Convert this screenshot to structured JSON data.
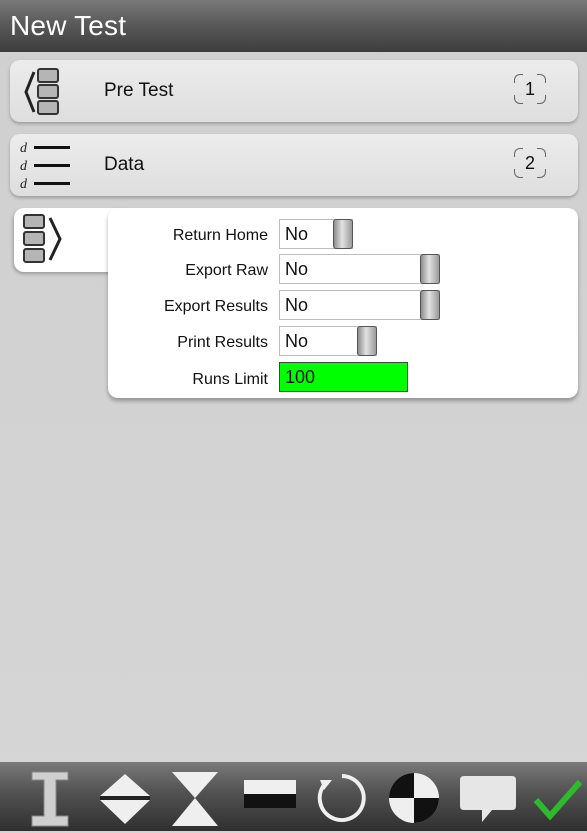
{
  "window": {
    "title": "New Test"
  },
  "rows": [
    {
      "label": "Pre Test",
      "badge": "1"
    },
    {
      "label": "Data",
      "badge": "2"
    }
  ],
  "settings": {
    "return_home": {
      "label": "Return Home",
      "value": "No"
    },
    "export_raw": {
      "label": "Export Raw",
      "value": "No"
    },
    "export_results": {
      "label": "Export Results",
      "value": "No"
    },
    "print_results": {
      "label": "Print Results",
      "value": "No"
    },
    "runs_limit": {
      "label": "Runs Limit",
      "value": "100"
    }
  },
  "toolbar": {
    "icons": [
      "i-beam-icon",
      "up-down-arrows-icon",
      "hourglass-icon",
      "rectangle-icon",
      "refresh-icon",
      "quadrant-circle-icon",
      "speech-bubble-icon",
      "checkmark-icon"
    ]
  },
  "colors": {
    "accent_field": "#00ff00",
    "check": "#2dbb2d"
  }
}
